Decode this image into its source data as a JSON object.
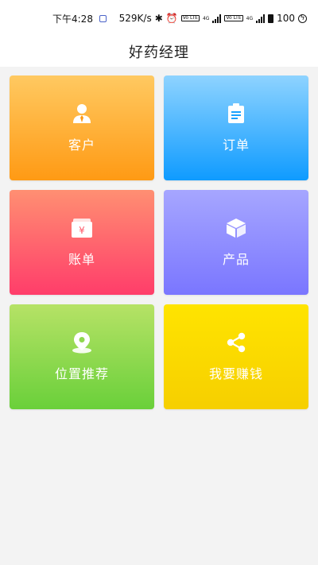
{
  "status_bar": {
    "time": "下午4:28",
    "net_speed": "529K/s",
    "volte1": "Vo LTE",
    "volte2": "Vo LTE",
    "net1": "4G",
    "net2": "4G",
    "battery": "100"
  },
  "header": {
    "title": "好药经理"
  },
  "tiles": [
    {
      "label": "客户",
      "icon": "customer-icon",
      "color_top": "#ffc961",
      "color_bottom": "#ff9a14"
    },
    {
      "label": "订单",
      "icon": "clipboard-icon",
      "color_top": "#8ed3ff",
      "color_bottom": "#0f9bff"
    },
    {
      "label": "账单",
      "icon": "wallet-icon",
      "color_top": "#ff8f72",
      "color_bottom": "#ff3d6a"
    },
    {
      "label": "产品",
      "icon": "box-icon",
      "color_top": "#a6a6ff",
      "color_bottom": "#7a76ff"
    },
    {
      "label": "位置推荐",
      "icon": "location-pin-icon",
      "color_top": "#b6e266",
      "color_bottom": "#6ad03a"
    },
    {
      "label": "我要赚钱",
      "icon": "share-icon",
      "color_top": "#ffe400",
      "color_bottom": "#f6cf00"
    }
  ]
}
